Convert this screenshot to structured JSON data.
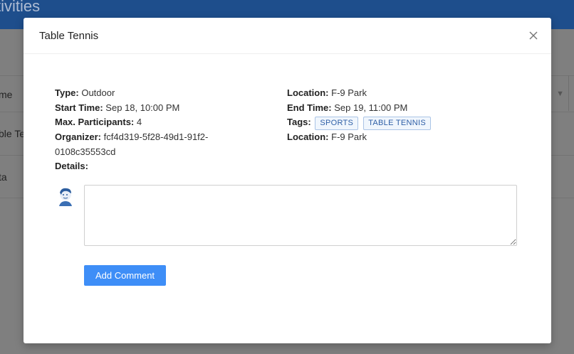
{
  "background": {
    "app_title": "ctivities",
    "col_header": "me",
    "row1": "ble Te",
    "row2": "ta"
  },
  "modal": {
    "title": "Table Tennis",
    "type_label": "Type:",
    "type_value": "Outdoor",
    "start_label": "Start Time:",
    "start_value": "Sep 18, 10:00 PM",
    "max_label": "Max. Participants:",
    "max_value": "4",
    "organizer_label": "Organizer:",
    "organizer_line1": "fcf4d319-5f28-49d1-91f2-",
    "organizer_line2": "0108c35553cd",
    "details_label": "Details:",
    "location_label": "Location:",
    "location_value": "F-9 Park",
    "end_label": "End Time:",
    "end_value": "Sep 19, 11:00 PM",
    "tags_label": "Tags:",
    "tags": [
      "SPORTS",
      "TABLE TENNIS"
    ],
    "location2_label": "Location:",
    "location2_value": "F-9 Park",
    "comment_value": "",
    "add_comment_label": "Add Comment"
  },
  "colors": {
    "primary": "#3e8ef7",
    "header_bar": "#1e4e8c",
    "tag_border": "#aac4e6",
    "tag_text": "#2e5fa6"
  },
  "icons": {
    "close": "close-icon",
    "avatar": "user-avatar"
  }
}
